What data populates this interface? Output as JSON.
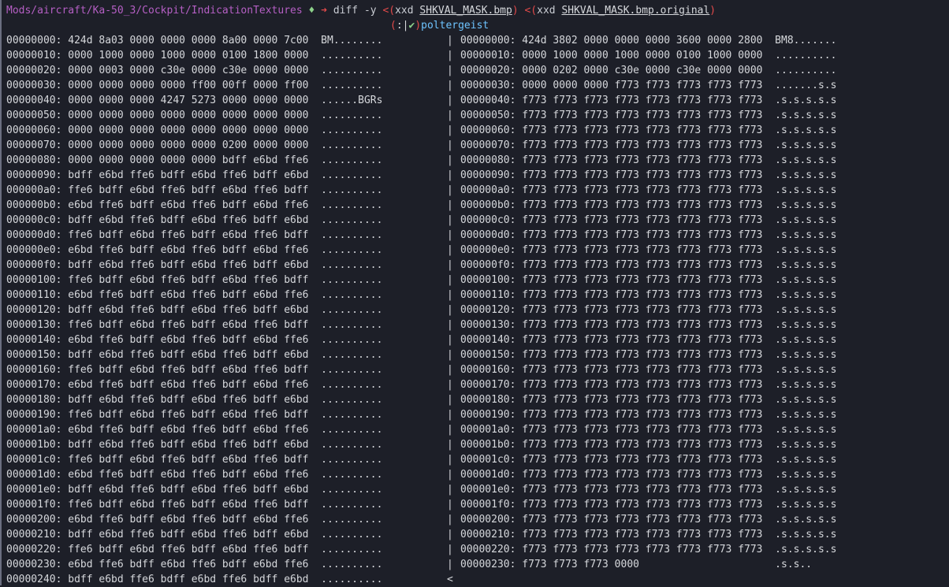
{
  "prompt": {
    "path": "Mods/aircraft/Ka-50_3/Cockpit/IndicationTextures",
    "diamond": "♦",
    "arrow": "➜",
    "cmd_diff": "diff -y",
    "sub_open": "<(",
    "xxd": "xxd",
    "file1": "SHKVAL_MASK.bmp",
    "sub_close": ")",
    "file2": "SHKVAL_MASK.bmp.original",
    "paren_open": "(",
    "colon": ":",
    "bar": "|",
    "check": "✔",
    "paren_close": ")",
    "host": "poltergeist"
  },
  "rows": [
    {
      "l": "00000000: 424d 8a03 0000 0000 0000 8a00 0000 7c00  BM........",
      "s": "|",
      "r": "00000000: 424d 3802 0000 0000 0000 3600 0000 2800  BM8......."
    },
    {
      "l": "00000010: 0000 1000 0000 1000 0000 0100 1800 0000  ..........",
      "s": "|",
      "r": "00000010: 0000 1000 0000 1000 0000 0100 1000 0000  .........."
    },
    {
      "l": "00000020: 0000 0003 0000 c30e 0000 c30e 0000 0000  ..........",
      "s": "|",
      "r": "00000020: 0000 0202 0000 c30e 0000 c30e 0000 0000  .........."
    },
    {
      "l": "00000030: 0000 0000 0000 0000 ff00 00ff 0000 ff00  ..........",
      "s": "|",
      "r": "00000030: 0000 0000 0000 f773 f773 f773 f773 f773  .......s.s"
    },
    {
      "l": "00000040: 0000 0000 0000 4247 5273 0000 0000 0000  ......BGRs",
      "s": "|",
      "r": "00000040: f773 f773 f773 f773 f773 f773 f773 f773  .s.s.s.s.s"
    },
    {
      "l": "00000050: 0000 0000 0000 0000 0000 0000 0000 0000  ..........",
      "s": "|",
      "r": "00000050: f773 f773 f773 f773 f773 f773 f773 f773  .s.s.s.s.s"
    },
    {
      "l": "00000060: 0000 0000 0000 0000 0000 0000 0000 0000  ..........",
      "s": "|",
      "r": "00000060: f773 f773 f773 f773 f773 f773 f773 f773  .s.s.s.s.s"
    },
    {
      "l": "00000070: 0000 0000 0000 0000 0000 0200 0000 0000  ..........",
      "s": "|",
      "r": "00000070: f773 f773 f773 f773 f773 f773 f773 f773  .s.s.s.s.s"
    },
    {
      "l": "00000080: 0000 0000 0000 0000 0000 bdff e6bd ffe6  ..........",
      "s": "|",
      "r": "00000080: f773 f773 f773 f773 f773 f773 f773 f773  .s.s.s.s.s"
    },
    {
      "l": "00000090: bdff e6bd ffe6 bdff e6bd ffe6 bdff e6bd  ..........",
      "s": "|",
      "r": "00000090: f773 f773 f773 f773 f773 f773 f773 f773  .s.s.s.s.s"
    },
    {
      "l": "000000a0: ffe6 bdff e6bd ffe6 bdff e6bd ffe6 bdff  ..........",
      "s": "|",
      "r": "000000a0: f773 f773 f773 f773 f773 f773 f773 f773  .s.s.s.s.s"
    },
    {
      "l": "000000b0: e6bd ffe6 bdff e6bd ffe6 bdff e6bd ffe6  ..........",
      "s": "|",
      "r": "000000b0: f773 f773 f773 f773 f773 f773 f773 f773  .s.s.s.s.s"
    },
    {
      "l": "000000c0: bdff e6bd ffe6 bdff e6bd ffe6 bdff e6bd  ..........",
      "s": "|",
      "r": "000000c0: f773 f773 f773 f773 f773 f773 f773 f773  .s.s.s.s.s"
    },
    {
      "l": "000000d0: ffe6 bdff e6bd ffe6 bdff e6bd ffe6 bdff  ..........",
      "s": "|",
      "r": "000000d0: f773 f773 f773 f773 f773 f773 f773 f773  .s.s.s.s.s"
    },
    {
      "l": "000000e0: e6bd ffe6 bdff e6bd ffe6 bdff e6bd ffe6  ..........",
      "s": "|",
      "r": "000000e0: f773 f773 f773 f773 f773 f773 f773 f773  .s.s.s.s.s"
    },
    {
      "l": "000000f0: bdff e6bd ffe6 bdff e6bd ffe6 bdff e6bd  ..........",
      "s": "|",
      "r": "000000f0: f773 f773 f773 f773 f773 f773 f773 f773  .s.s.s.s.s"
    },
    {
      "l": "00000100: ffe6 bdff e6bd ffe6 bdff e6bd ffe6 bdff  ..........",
      "s": "|",
      "r": "00000100: f773 f773 f773 f773 f773 f773 f773 f773  .s.s.s.s.s"
    },
    {
      "l": "00000110: e6bd ffe6 bdff e6bd ffe6 bdff e6bd ffe6  ..........",
      "s": "|",
      "r": "00000110: f773 f773 f773 f773 f773 f773 f773 f773  .s.s.s.s.s"
    },
    {
      "l": "00000120: bdff e6bd ffe6 bdff e6bd ffe6 bdff e6bd  ..........",
      "s": "|",
      "r": "00000120: f773 f773 f773 f773 f773 f773 f773 f773  .s.s.s.s.s"
    },
    {
      "l": "00000130: ffe6 bdff e6bd ffe6 bdff e6bd ffe6 bdff  ..........",
      "s": "|",
      "r": "00000130: f773 f773 f773 f773 f773 f773 f773 f773  .s.s.s.s.s"
    },
    {
      "l": "00000140: e6bd ffe6 bdff e6bd ffe6 bdff e6bd ffe6  ..........",
      "s": "|",
      "r": "00000140: f773 f773 f773 f773 f773 f773 f773 f773  .s.s.s.s.s"
    },
    {
      "l": "00000150: bdff e6bd ffe6 bdff e6bd ffe6 bdff e6bd  ..........",
      "s": "|",
      "r": "00000150: f773 f773 f773 f773 f773 f773 f773 f773  .s.s.s.s.s"
    },
    {
      "l": "00000160: ffe6 bdff e6bd ffe6 bdff e6bd ffe6 bdff  ..........",
      "s": "|",
      "r": "00000160: f773 f773 f773 f773 f773 f773 f773 f773  .s.s.s.s.s"
    },
    {
      "l": "00000170: e6bd ffe6 bdff e6bd ffe6 bdff e6bd ffe6  ..........",
      "s": "|",
      "r": "00000170: f773 f773 f773 f773 f773 f773 f773 f773  .s.s.s.s.s"
    },
    {
      "l": "00000180: bdff e6bd ffe6 bdff e6bd ffe6 bdff e6bd  ..........",
      "s": "|",
      "r": "00000180: f773 f773 f773 f773 f773 f773 f773 f773  .s.s.s.s.s"
    },
    {
      "l": "00000190: ffe6 bdff e6bd ffe6 bdff e6bd ffe6 bdff  ..........",
      "s": "|",
      "r": "00000190: f773 f773 f773 f773 f773 f773 f773 f773  .s.s.s.s.s"
    },
    {
      "l": "000001a0: e6bd ffe6 bdff e6bd ffe6 bdff e6bd ffe6  ..........",
      "s": "|",
      "r": "000001a0: f773 f773 f773 f773 f773 f773 f773 f773  .s.s.s.s.s"
    },
    {
      "l": "000001b0: bdff e6bd ffe6 bdff e6bd ffe6 bdff e6bd  ..........",
      "s": "|",
      "r": "000001b0: f773 f773 f773 f773 f773 f773 f773 f773  .s.s.s.s.s"
    },
    {
      "l": "000001c0: ffe6 bdff e6bd ffe6 bdff e6bd ffe6 bdff  ..........",
      "s": "|",
      "r": "000001c0: f773 f773 f773 f773 f773 f773 f773 f773  .s.s.s.s.s"
    },
    {
      "l": "000001d0: e6bd ffe6 bdff e6bd ffe6 bdff e6bd ffe6  ..........",
      "s": "|",
      "r": "000001d0: f773 f773 f773 f773 f773 f773 f773 f773  .s.s.s.s.s"
    },
    {
      "l": "000001e0: bdff e6bd ffe6 bdff e6bd ffe6 bdff e6bd  ..........",
      "s": "|",
      "r": "000001e0: f773 f773 f773 f773 f773 f773 f773 f773  .s.s.s.s.s"
    },
    {
      "l": "000001f0: ffe6 bdff e6bd ffe6 bdff e6bd ffe6 bdff  ..........",
      "s": "|",
      "r": "000001f0: f773 f773 f773 f773 f773 f773 f773 f773  .s.s.s.s.s"
    },
    {
      "l": "00000200: e6bd ffe6 bdff e6bd ffe6 bdff e6bd ffe6  ..........",
      "s": "|",
      "r": "00000200: f773 f773 f773 f773 f773 f773 f773 f773  .s.s.s.s.s"
    },
    {
      "l": "00000210: bdff e6bd ffe6 bdff e6bd ffe6 bdff e6bd  ..........",
      "s": "|",
      "r": "00000210: f773 f773 f773 f773 f773 f773 f773 f773  .s.s.s.s.s"
    },
    {
      "l": "00000220: ffe6 bdff e6bd ffe6 bdff e6bd ffe6 bdff  ..........",
      "s": "|",
      "r": "00000220: f773 f773 f773 f773 f773 f773 f773 f773  .s.s.s.s.s"
    },
    {
      "l": "00000230: e6bd ffe6 bdff e6bd ffe6 bdff e6bd ffe6  ..........",
      "s": "|",
      "r": "00000230: f773 f773 f773 0000                      .s.s.."
    },
    {
      "l": "00000240: bdff e6bd ffe6 bdff e6bd ffe6 bdff e6bd  ..........",
      "s": "<",
      "r": ""
    }
  ]
}
